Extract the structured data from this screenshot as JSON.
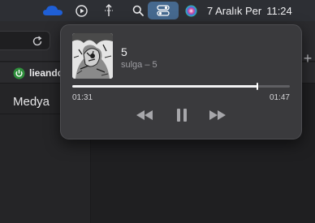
{
  "menubar": {
    "icons": [
      "cloud-icon",
      "play-circle-icon",
      "network-icon",
      "spotlight-icon",
      "control-center-icon",
      "siri-icon"
    ],
    "date": "7 Aralık Per",
    "time": "11:24"
  },
  "browser": {
    "bookmark_label": "lieandd",
    "sidebar_tab": "Medya",
    "new_tab_symbol": "+"
  },
  "now_playing": {
    "title": "5",
    "subtitle": "sulga – 5",
    "elapsed": "01:31",
    "total": "01:47",
    "progress": 0.85,
    "accent_color": "#f2f2f4"
  }
}
